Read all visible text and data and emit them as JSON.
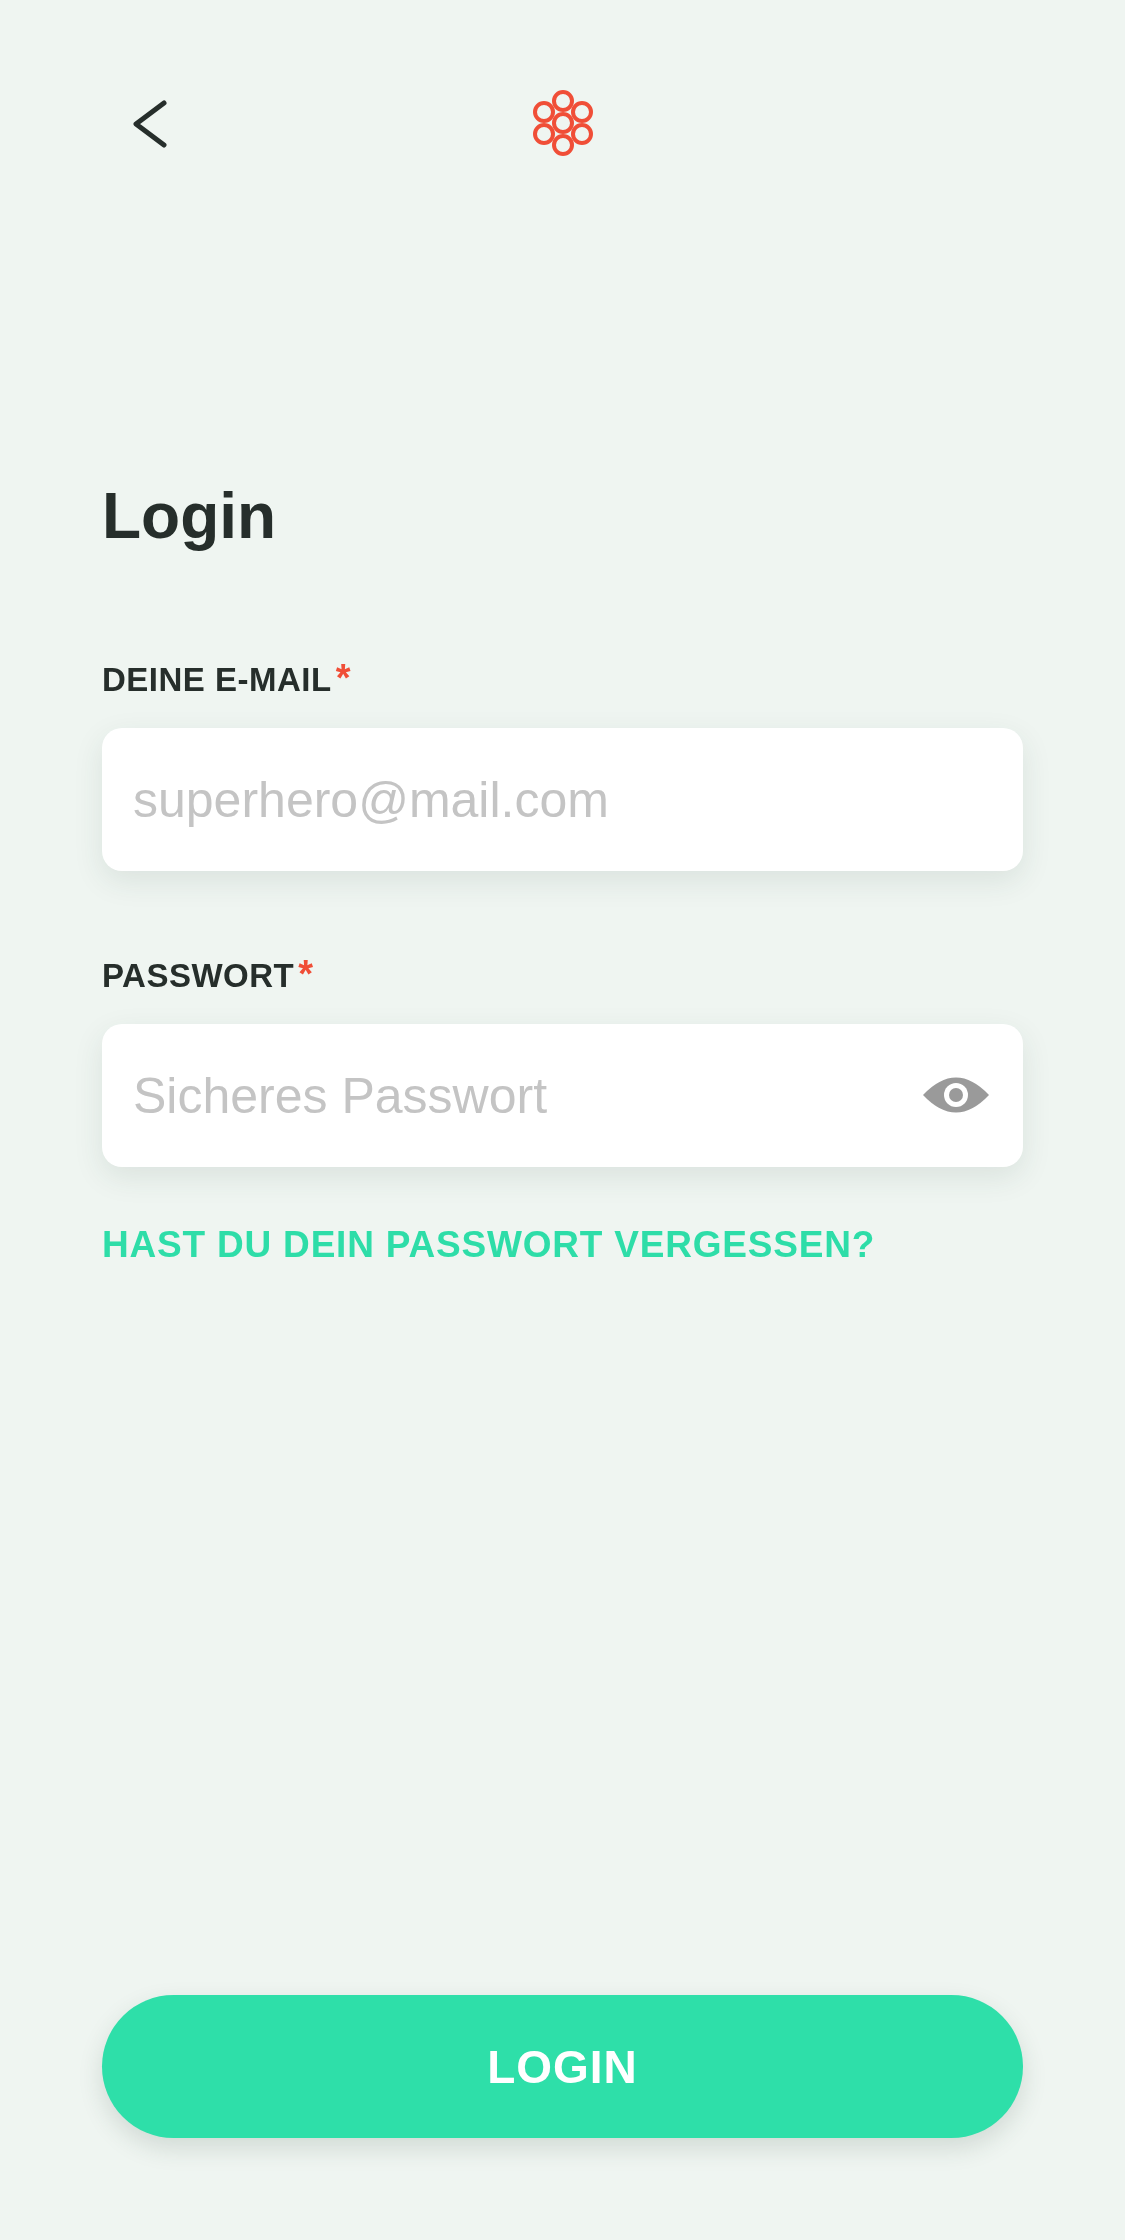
{
  "title": "Login",
  "fields": [
    {
      "kind": "email",
      "label": "DEINE E-MAIL",
      "required_mark": "*",
      "placeholder": "superhero@mail.com"
    },
    {
      "kind": "password",
      "label": "PASSWORT",
      "required_mark": "*",
      "placeholder": "Sicheres Passwort"
    }
  ],
  "forgot_link": "HAST DU DEIN PASSWORT VERGESSEN?",
  "login_button": "LOGIN"
}
